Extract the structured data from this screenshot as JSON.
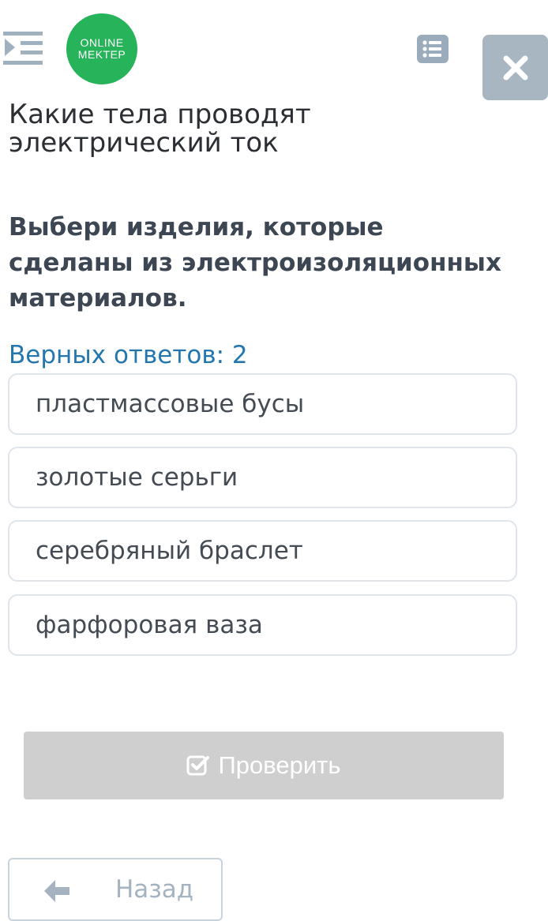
{
  "header": {
    "logo_line1": "ONLINE",
    "logo_line2": "MEKTEP",
    "menu_icon": "indent-menu-icon",
    "list_icon": "list-icon",
    "close_icon": "close-icon"
  },
  "question": {
    "title": "Какие тела проводят электрический ток",
    "task": "Выбери изделия, которые сделаны из электроизоляционных материалов.",
    "answers_count": "Верных ответов: 2"
  },
  "options": [
    "пластмассовые бусы",
    "золотые серьги",
    "серебряный браслет",
    "фарфоровая ваза"
  ],
  "actions": {
    "check_label": "Проверить",
    "back_label": "Назад"
  },
  "colors": {
    "logo": "#27b35a",
    "accent_text": "#2477ae",
    "disabled_button": "#cfcfcf",
    "close_button": "#a8b6c2"
  }
}
